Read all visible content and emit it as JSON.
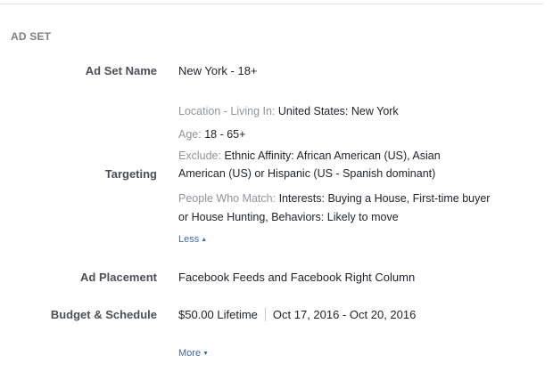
{
  "section": {
    "heading": "AD SET"
  },
  "ad_set_name": {
    "label": "Ad Set Name",
    "value": "New York - 18+"
  },
  "targeting": {
    "label": "Targeting",
    "location_label": "Location - Living In:",
    "location_value": "United States: New York",
    "age_label": "Age:",
    "age_value": "18 - 65+",
    "exclude_label": "Exclude:",
    "exclude_value_line1": "Ethnic Affinity: African American (US), Asian",
    "exclude_value_line2": "American (US) or Hispanic (US - Spanish dominant)",
    "people_label": "People Who Match:",
    "people_value_line1": "Interests: Buying a House, First-time buyer",
    "people_value_line2": "or House Hunting, Behaviors: Likely to move",
    "less_link": "Less",
    "less_icon": "caret-up-icon"
  },
  "ad_placement": {
    "label": "Ad Placement",
    "value": "Facebook Feeds and Facebook Right Column"
  },
  "budget_schedule": {
    "label": "Budget & Schedule",
    "budget": "$50.00 Lifetime",
    "schedule": "Oct 17, 2016 - Oct 20, 2016"
  },
  "more_link": {
    "label": "More",
    "icon": "caret-down-icon"
  },
  "colors": {
    "link": "#4267b2",
    "muted": "#90949c",
    "label": "#4b4f56",
    "text": "#1d2129"
  }
}
